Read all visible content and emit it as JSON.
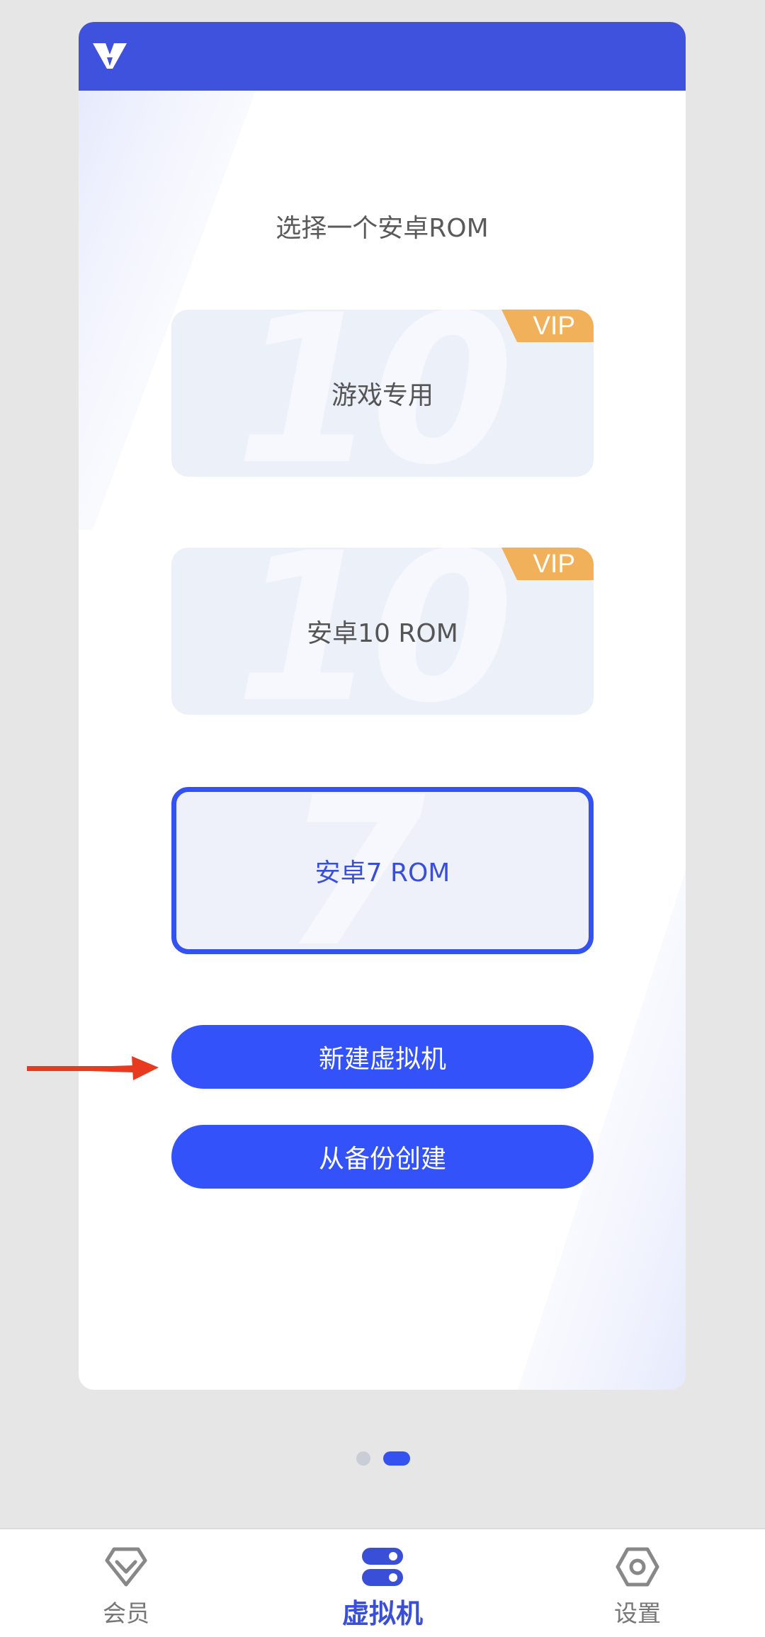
{
  "card": {
    "title": "选择一个安卓ROM",
    "roms": [
      {
        "label": "游戏专用",
        "badge": "VIP",
        "watermark": "10",
        "selected": false
      },
      {
        "label": "安卓10 ROM",
        "badge": "VIP",
        "watermark": "10",
        "selected": false
      },
      {
        "label": "安卓7 ROM",
        "badge": "",
        "watermark": "7",
        "selected": true
      }
    ],
    "buttons": {
      "create": "新建虚拟机",
      "from_backup": "从备份创建"
    }
  },
  "pager": {
    "pages": 2,
    "current": 2
  },
  "tabbar": {
    "items": [
      {
        "label": "会员",
        "icon": "diamond-icon"
      },
      {
        "label": "虚拟机",
        "icon": "server-icon"
      },
      {
        "label": "设置",
        "icon": "hexagon-settings-icon"
      }
    ],
    "active_index": 1
  },
  "colors": {
    "header": "#3e52dd",
    "accent": "#3352f9",
    "vip_badge": "#f0b15a",
    "annotation_arrow": "#e83a1f"
  }
}
